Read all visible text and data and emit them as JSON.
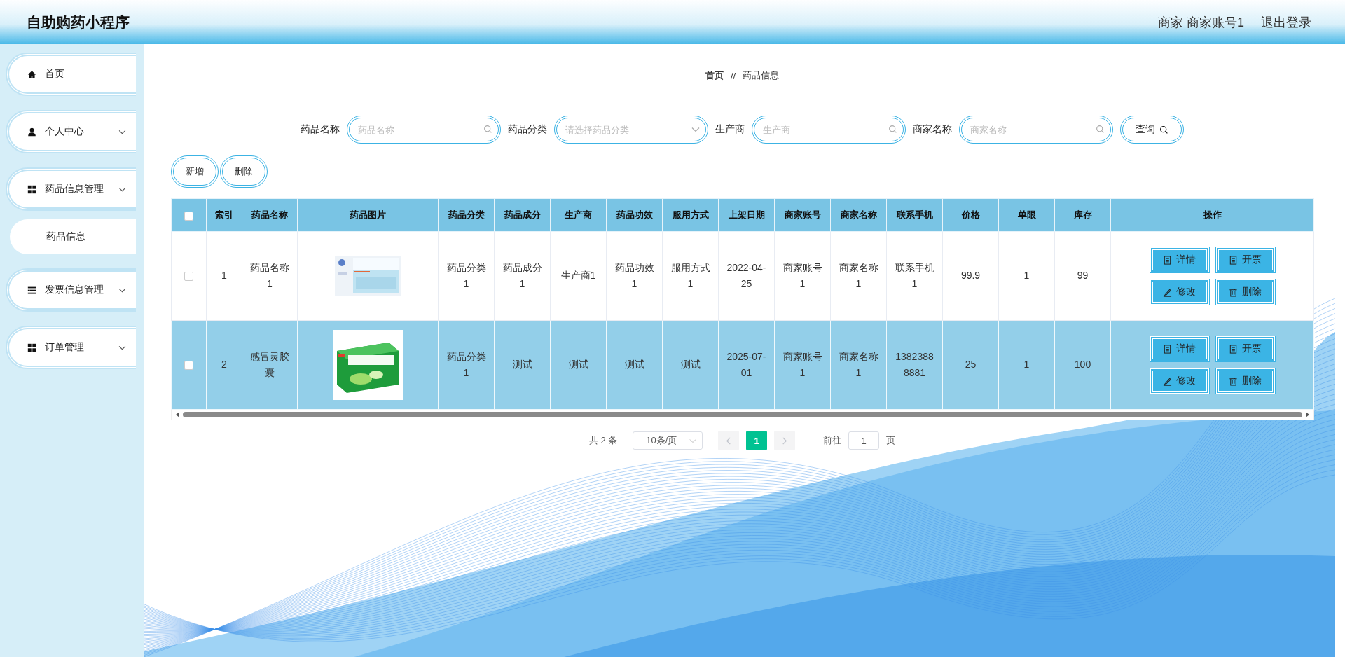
{
  "header": {
    "title": "自助购药小程序",
    "user": "商家 商家账号1",
    "logout": "退出登录"
  },
  "sidebar": {
    "items": [
      {
        "label": "首页",
        "kind": "link"
      },
      {
        "label": "个人中心",
        "kind": "menu"
      },
      {
        "label": "药品信息管理",
        "kind": "menu",
        "expanded": true,
        "children": [
          {
            "label": "药品信息"
          }
        ]
      },
      {
        "label": "发票信息管理",
        "kind": "menu"
      },
      {
        "label": "订单管理",
        "kind": "menu"
      }
    ]
  },
  "breadcrumb": [
    "首页",
    "//",
    "药品信息"
  ],
  "search": {
    "fields": [
      {
        "label": "药品名称",
        "kind": "input",
        "placeholder": "药品名称"
      },
      {
        "label": "药品分类",
        "kind": "select",
        "placeholder": "请选择药品分类"
      },
      {
        "label": "生产商",
        "kind": "input",
        "placeholder": "生产商"
      },
      {
        "label": "商家名称",
        "kind": "input",
        "placeholder": "商家名称"
      }
    ],
    "button": "查询"
  },
  "toolbar": [
    "新增",
    "删除"
  ],
  "table": {
    "select_all": {
      "checked": false
    },
    "columns": [
      "索引",
      "药品名称",
      "药品图片",
      "药品分类",
      "药品成分",
      "生产商",
      "药品功效",
      "服用方式",
      "上架日期",
      "商家账号",
      "商家名称",
      "联系手机",
      "价格",
      "单限",
      "库存",
      "操作"
    ],
    "rows": [
      {
        "checked": false,
        "highlighted": false,
        "image": {
          "kind": "picture"
        },
        "cells": [
          "1",
          "药品名称1",
          "",
          "药品分类1",
          "药品成分1",
          "生产商1",
          "药品功效1",
          "服用方式1",
          "2022-04-25",
          "商家账号1",
          "商家名称1",
          "联系手机1",
          "99.9",
          "1",
          "99"
        ],
        "actions": [
          "详情",
          "开票",
          "修改",
          "删除"
        ]
      },
      {
        "checked": false,
        "highlighted": true,
        "image": {
          "kind": "picture"
        },
        "cells": [
          "2",
          "感冒灵胶囊",
          "",
          "药品分类1",
          "测试",
          "测试",
          "测试",
          "测试",
          "2025-07-01",
          "商家账号1",
          "商家名称1",
          "13823888881",
          "25",
          "1",
          "100"
        ],
        "actions": [
          "详情",
          "开票",
          "修改",
          "删除"
        ]
      }
    ]
  },
  "pagination": {
    "total": "共 2 条",
    "page_size": "10条/页",
    "prev": {
      "disabled": true
    },
    "pages": [
      {
        "label": "1",
        "selected": true
      }
    ],
    "next": {
      "disabled": true
    },
    "goto_label": "前往",
    "goto_value": "1",
    "goto_suffix": "页"
  }
}
